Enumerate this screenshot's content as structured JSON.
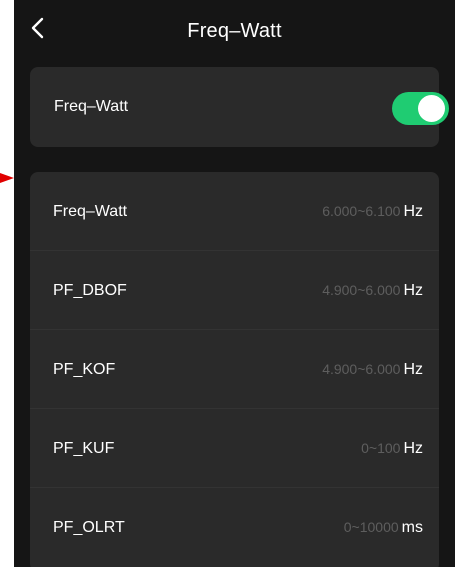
{
  "header": {
    "title": "Freq–Watt",
    "back_icon": "chevron-left-icon"
  },
  "toggle_card": {
    "label": "Freq–Watt",
    "enabled": true,
    "switch_color": "#1fcc72"
  },
  "settings": [
    {
      "name": "Freq–Watt",
      "range": "6.000~6.100",
      "unit": "Hz"
    },
    {
      "name": "PF_DBOF",
      "range": "4.900~6.000",
      "unit": "Hz"
    },
    {
      "name": "PF_KOF",
      "range": "4.900~6.000",
      "unit": "Hz"
    },
    {
      "name": "PF_KUF",
      "range": "0~100",
      "unit": "Hz"
    },
    {
      "name": "PF_OLRT",
      "range": "0~10000",
      "unit": "ms"
    }
  ],
  "colors": {
    "background": "#151515",
    "card": "#2a2a2a",
    "accent": "#1fcc72",
    "annotation_arrow": "#e00000"
  }
}
